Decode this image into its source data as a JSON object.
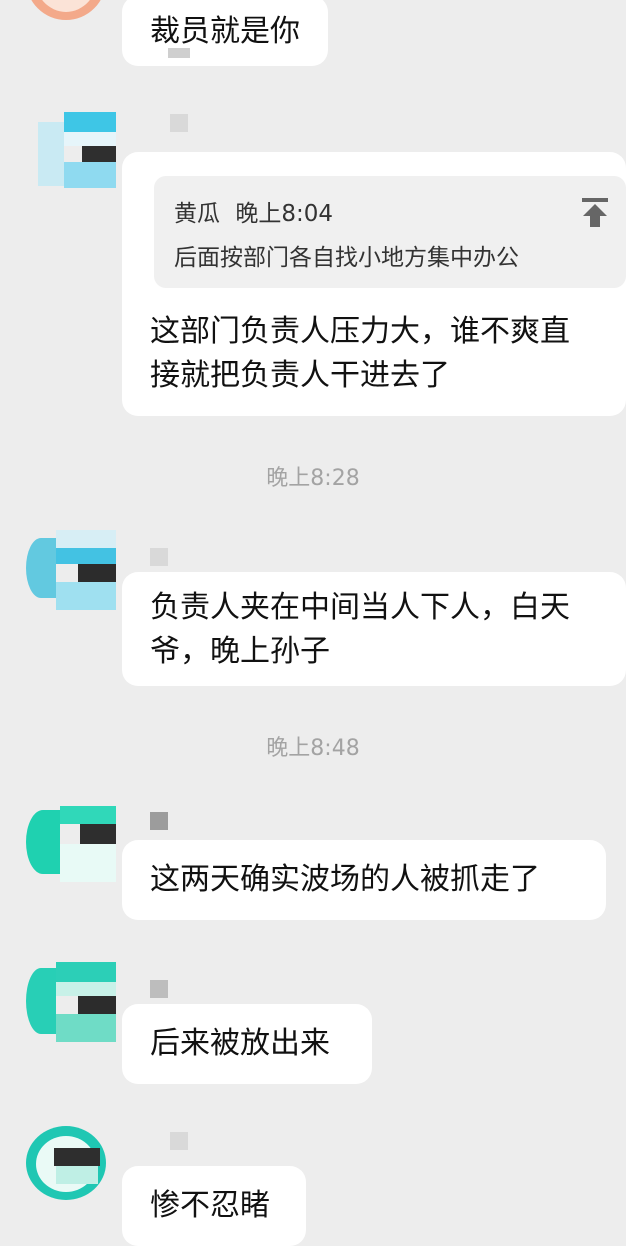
{
  "colors": {
    "background": "#ededed",
    "bubble": "#ffffff",
    "quote_background": "#f0f0f0",
    "timestamp_text": "#a3a3a3"
  },
  "messages": {
    "m0": {
      "text": "裁员就是你"
    },
    "m1": {
      "quote": {
        "sender": "黄瓜",
        "time": "晚上8:04",
        "text": "后面按部门各自找小地方集中办公",
        "icon": "jump-to-top-icon"
      },
      "text_line1": "这部门负责人压力大，谁不爽直",
      "text_line2": "接就把负责人干进去了"
    },
    "m2": {
      "text_line1": "负责人夹在中间当人下人，白天",
      "text_line2": "爷，晚上孙子"
    },
    "m3": {
      "text": "这两天确实波场的人被抓走了"
    },
    "m4": {
      "text": "后来被放出来"
    },
    "m5": {
      "text": "惨不忍睹"
    }
  },
  "timestamps": {
    "t1": "晚上8:28",
    "t2": "晚上8:48"
  }
}
